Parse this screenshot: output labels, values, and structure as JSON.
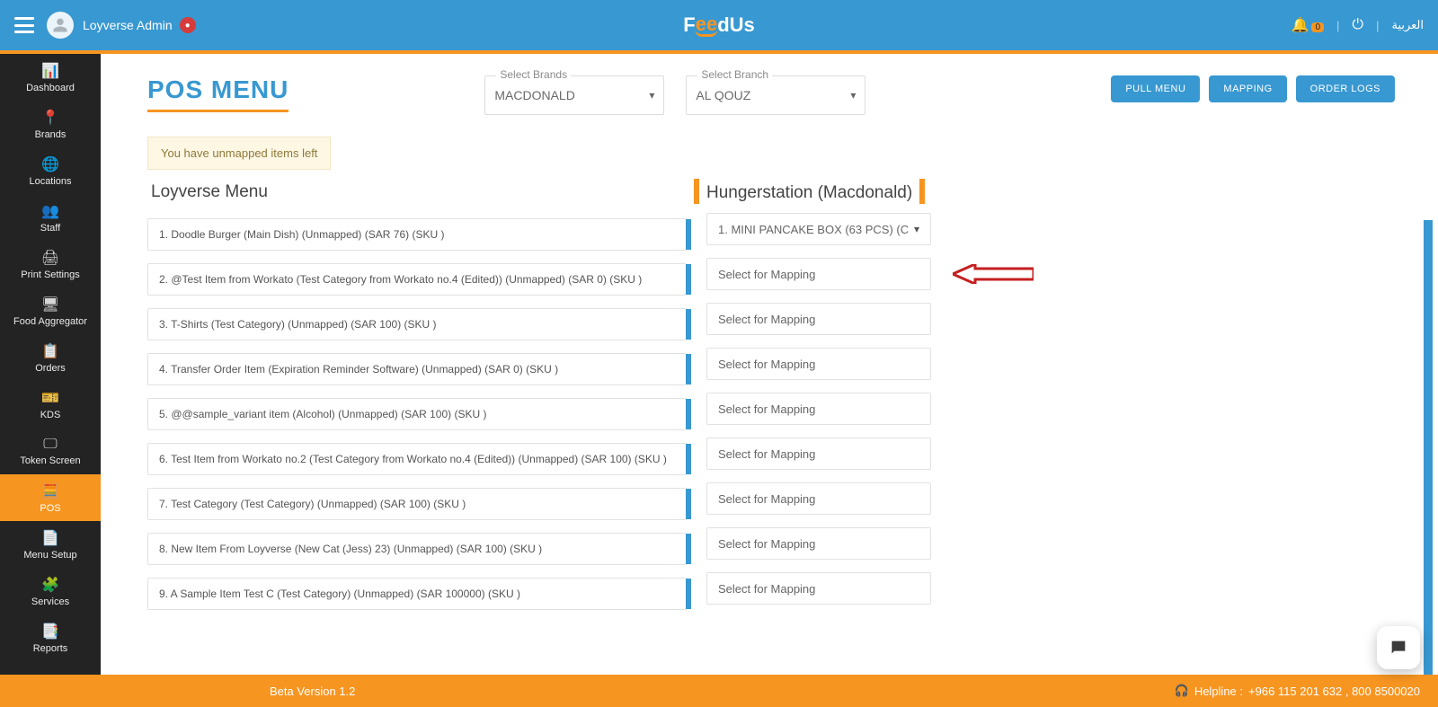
{
  "header": {
    "user_name": "Loyverse Admin",
    "brand_part1": "F",
    "brand_part2": "ee",
    "brand_part3": "dUs",
    "bell_badge": "0",
    "lang": "العربية"
  },
  "sidebar": {
    "items": [
      {
        "label": "Dashboard",
        "icon": "📊"
      },
      {
        "label": "Brands",
        "icon": "📍"
      },
      {
        "label": "Locations",
        "icon": "🌐"
      },
      {
        "label": "Staff",
        "icon": "👥"
      },
      {
        "label": "Print Settings",
        "icon": "🖨"
      },
      {
        "label": "Food Aggregator",
        "icon": "🖥"
      },
      {
        "label": "Orders",
        "icon": "📋"
      },
      {
        "label": "KDS",
        "icon": "🎫"
      },
      {
        "label": "Token Screen",
        "icon": "🖵"
      },
      {
        "label": "POS",
        "icon": "🧮"
      },
      {
        "label": "Menu Setup",
        "icon": "📄"
      },
      {
        "label": "Services",
        "icon": "🧩"
      },
      {
        "label": "Reports",
        "icon": "📑"
      }
    ]
  },
  "page": {
    "title": "POS MENU",
    "select_brands_label": "Select Brands",
    "select_brands_value": "MACDONALD",
    "select_branch_label": "Select Branch",
    "select_branch_value": "AL QOUZ",
    "buttons": {
      "pull": "PULL MENU",
      "mapping": "MAPPING",
      "orderlogs": "ORDER LOGS"
    },
    "alert": "You have unmapped items left"
  },
  "columns": {
    "left_title": "Loyverse Menu",
    "right_title": "Hungerstation (Macdonald)"
  },
  "menu_items": [
    "1. Doodle Burger (Main Dish) (Unmapped) (SAR 76) (SKU )",
    "2. @Test Item from Workato (Test Category from Workato no.4 (Edited)) (Unmapped) (SAR 0) (SKU )",
    "3. T-Shirts (Test Category) (Unmapped) (SAR 100) (SKU )",
    "4. Transfer Order Item (Expiration Reminder Software) (Unmapped) (SAR 0) (SKU )",
    "5. @@sample_variant item (Alcohol) (Unmapped) (SAR 100) (SKU )",
    "6. Test Item from Workato no.2 (Test Category from Workato no.4 (Edited)) (Unmapped) (SAR 100) (SKU )",
    "7. Test Category (Test Category) (Unmapped) (SAR 100) (SKU )",
    "8. New Item From Loyverse (New Cat (Jess) 23) (Unmapped) (SAR 100) (SKU )",
    "9. A Sample Item Test C (Test Category) (Unmapped) (SAR 100000) (SKU )"
  ],
  "mapping_items": [
    {
      "text": "1. MINI PANCAKE BOX (63 PCS) (C",
      "selected": true
    },
    {
      "text": "Select for Mapping"
    },
    {
      "text": "Select for Mapping"
    },
    {
      "text": "Select for Mapping"
    },
    {
      "text": "Select for Mapping"
    },
    {
      "text": "Select for Mapping"
    },
    {
      "text": "Select for Mapping"
    },
    {
      "text": "Select for Mapping"
    },
    {
      "text": "Select for Mapping"
    }
  ],
  "footer": {
    "version": "Beta Version 1.2",
    "helpline_label": "Helpline : ",
    "helpline_numbers": "+966 115 201 632 , 800 8500020"
  }
}
